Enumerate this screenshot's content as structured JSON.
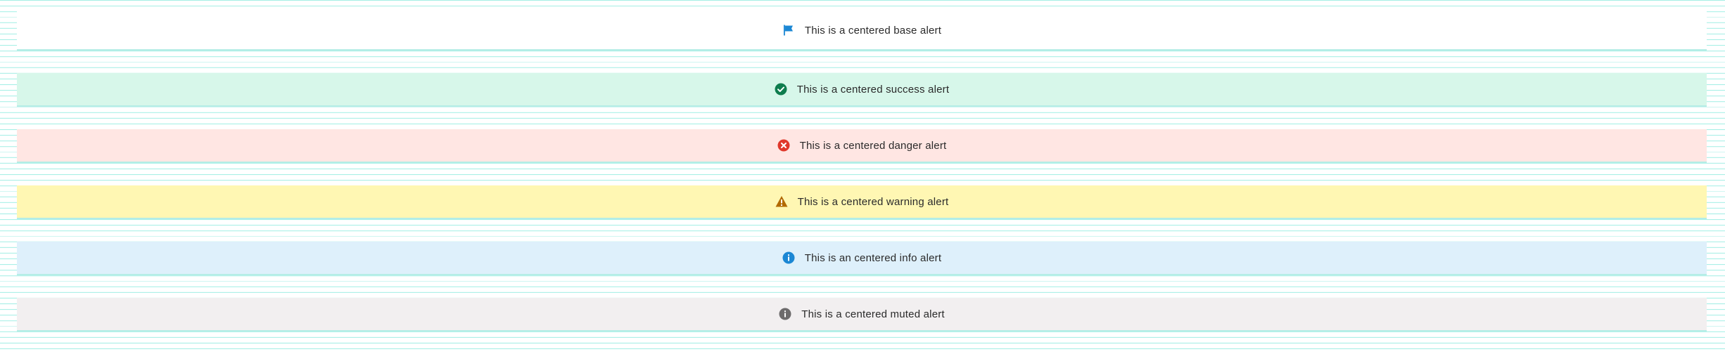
{
  "alerts": [
    {
      "variant": "base",
      "icon": "flag-icon",
      "icon_color": "#1b87d4",
      "text": "This is a centered base alert"
    },
    {
      "variant": "success",
      "icon": "check-circle-icon",
      "icon_color": "#0e7d4e",
      "text": "This is a centered success alert"
    },
    {
      "variant": "danger",
      "icon": "x-circle-icon",
      "icon_color": "#e0382b",
      "text": "This is a centered danger alert"
    },
    {
      "variant": "warning",
      "icon": "warning-icon",
      "icon_color": "#b26a00",
      "text": "This is a centered warning alert"
    },
    {
      "variant": "info",
      "icon": "info-circle-icon",
      "icon_color": "#1b87d4",
      "text": "This is an centered info alert"
    },
    {
      "variant": "muted",
      "icon": "info-circle-icon",
      "icon_color": "#6d6b6c",
      "text": "This is a centered muted alert"
    }
  ],
  "colors": {
    "base_bg": "#ffffff",
    "success_bg": "#d7f7ea",
    "danger_bg": "#ffe6e3",
    "warning_bg": "#fff7b3",
    "info_bg": "#def0fb",
    "muted_bg": "#f2eff0",
    "grid_line": "#a6efe6"
  }
}
